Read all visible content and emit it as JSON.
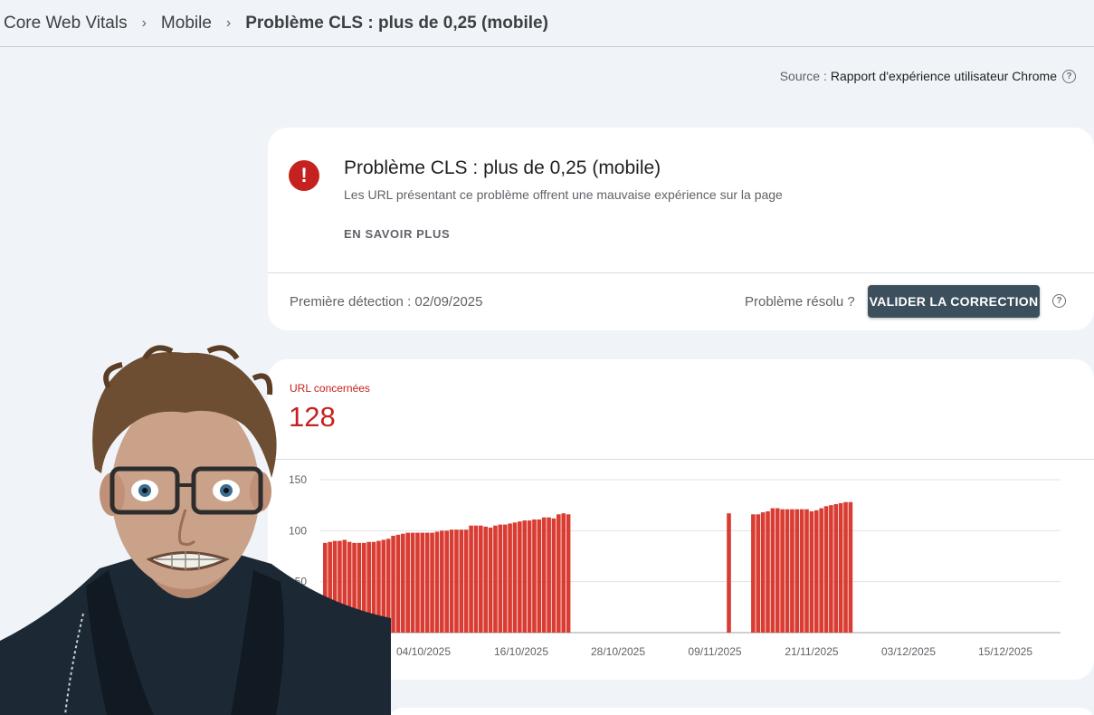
{
  "breadcrumb": {
    "items": [
      "Core Web Vitals",
      "Mobile"
    ],
    "current": "Problème CLS : plus de 0,25 (mobile)",
    "separator": "›"
  },
  "source": {
    "label": "Source :",
    "value": "Rapport d'expérience utilisateur Chrome",
    "help_icon": "help-circle-icon"
  },
  "issue": {
    "icon": "error-exclamation-icon",
    "title": "Problème CLS : plus de 0,25 (mobile)",
    "description": "Les URL présentant ce problème offrent une mauvaise expérience sur la page",
    "learn_more": "EN SAVOIR PLUS",
    "first_detection": "Première détection : 02/09/2025",
    "resolved_question": "Problème résolu ?",
    "validate_button": "VALIDER LA CORRECTION"
  },
  "affected": {
    "label": "URL concernées",
    "count": "128"
  },
  "colors": {
    "error": "#c5221f",
    "bar": "#d93c32",
    "button": "#3c4f5c",
    "background": "#f0f4f9"
  },
  "chart_data": {
    "type": "bar",
    "ylim": [
      0,
      150
    ],
    "yticks": [
      50,
      100,
      150
    ],
    "grid": true,
    "x_tick_labels": [
      "04/10/2025",
      "16/10/2025",
      "28/10/2025",
      "09/11/2025",
      "21/11/2025",
      "03/12/2025",
      "15/12/2025"
    ],
    "series": [
      {
        "values": [
          88,
          89,
          90,
          90,
          91,
          89,
          88,
          88,
          88,
          89,
          89,
          90,
          91,
          92,
          95,
          96,
          97,
          98,
          98,
          98,
          98,
          98,
          98,
          99,
          100,
          100,
          101,
          101,
          101,
          101,
          105,
          105,
          105,
          104,
          103,
          105,
          106,
          106,
          107,
          108,
          109,
          110,
          110,
          111,
          111,
          113,
          113,
          112,
          116,
          117,
          116,
          null,
          null,
          null,
          null,
          null,
          null,
          null,
          null,
          null,
          null,
          null,
          null,
          null,
          null,
          null,
          null,
          null,
          null,
          null,
          null,
          null,
          null,
          null,
          null,
          null,
          null,
          null,
          null,
          null,
          null,
          null,
          null,
          117,
          null,
          null,
          null,
          null,
          116,
          116,
          118,
          119,
          122,
          122,
          121,
          121,
          121,
          121,
          121,
          121,
          119,
          120,
          122,
          124,
          125,
          126,
          127,
          128,
          128
        ]
      }
    ]
  }
}
